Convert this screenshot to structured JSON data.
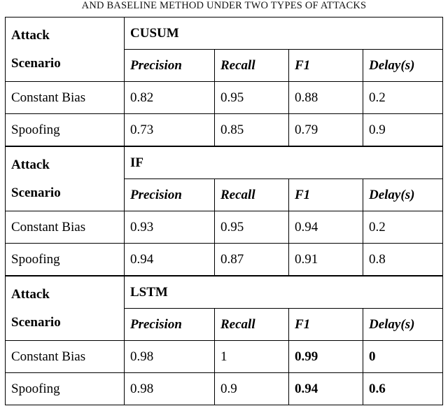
{
  "caption": {
    "text": "AND BASELINE METHOD UNDER TWO TYPES OF ATTACKS",
    "leading_word": "and",
    "rest": "Baseline Method Under Two Types of Attacks"
  },
  "table": {
    "scenario_header": {
      "line1": "Attack",
      "line2": "Scenario"
    },
    "metric_headers": [
      "Precision",
      "Recall",
      "F1",
      "Delay(s)"
    ],
    "row_labels": [
      "Constant Bias",
      "Spoofing"
    ],
    "sections": [
      {
        "method": "CUSUM",
        "rows": [
          {
            "label": "Constant Bias",
            "values": [
              "0.82",
              "0.95",
              "0.88",
              "0.2"
            ],
            "bold": [
              false,
              false,
              false,
              false
            ]
          },
          {
            "label": "Spoofing",
            "values": [
              "0.73",
              "0.85",
              "0.79",
              "0.9"
            ],
            "bold": [
              false,
              false,
              false,
              false
            ]
          }
        ]
      },
      {
        "method": "IF",
        "rows": [
          {
            "label": "Constant Bias",
            "values": [
              "0.93",
              "0.95",
              "0.94",
              "0.2"
            ],
            "bold": [
              false,
              false,
              false,
              false
            ]
          },
          {
            "label": "Spoofing",
            "values": [
              "0.94",
              "0.87",
              "0.91",
              "0.8"
            ],
            "bold": [
              false,
              false,
              false,
              false
            ]
          }
        ]
      },
      {
        "method": "LSTM",
        "rows": [
          {
            "label": "Constant Bias",
            "values": [
              "0.98",
              "1",
              "0.99",
              "0"
            ],
            "bold": [
              false,
              false,
              true,
              true
            ]
          },
          {
            "label": "Spoofing",
            "values": [
              "0.98",
              "0.9",
              "0.94",
              "0.6"
            ],
            "bold": [
              false,
              false,
              true,
              true
            ]
          }
        ]
      }
    ]
  },
  "colors": {
    "text": "#000000",
    "background": "#ffffff",
    "border": "#000000"
  }
}
